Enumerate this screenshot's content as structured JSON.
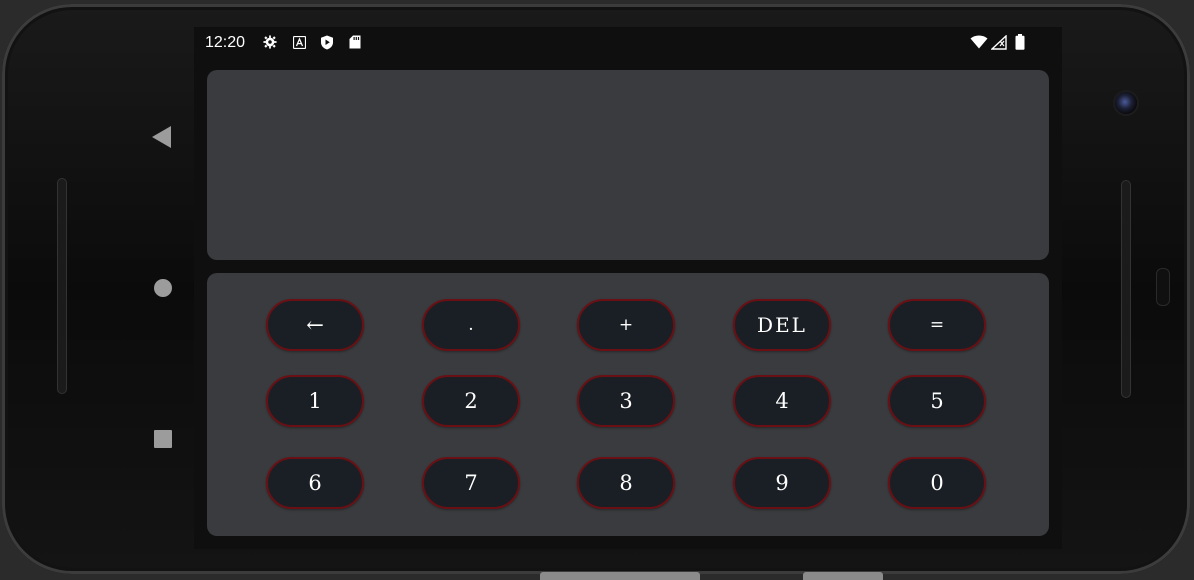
{
  "status_bar": {
    "time": "12:20",
    "left_icons": [
      "gear-icon",
      "a-icon",
      "shield-play-icon",
      "sd-card-icon"
    ],
    "right_icons": [
      "wifi-icon",
      "signal-icon",
      "battery-icon"
    ]
  },
  "display": {
    "value": ""
  },
  "keypad": {
    "row1": [
      "←",
      ".",
      "+",
      "DEL",
      "="
    ],
    "row2": [
      "1",
      "2",
      "3",
      "4",
      "5"
    ],
    "row3": [
      "6",
      "7",
      "8",
      "9",
      "0"
    ]
  },
  "colors": {
    "panel": "#3a3b3e",
    "key_bg": "#1a1f25",
    "key_border": "#6a1014",
    "screen_bg": "#0f0f0f"
  }
}
